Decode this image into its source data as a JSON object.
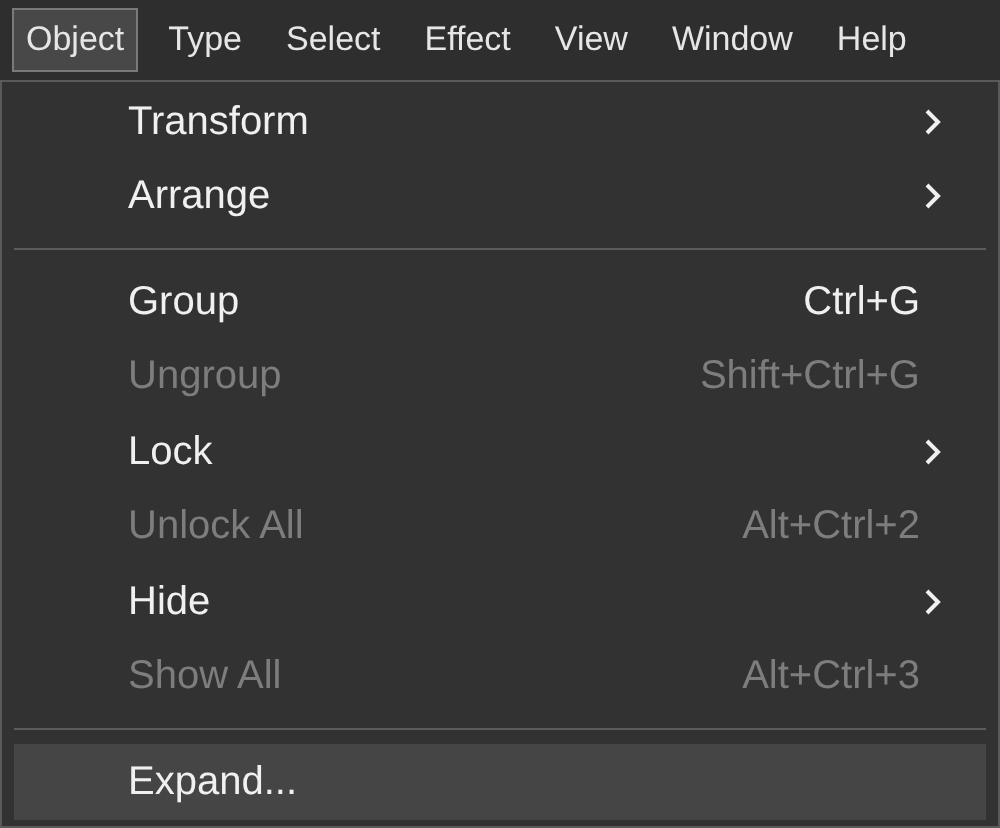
{
  "menu_bar": [
    {
      "label": "Object",
      "selected": true
    },
    {
      "label": "Type",
      "selected": false
    },
    {
      "label": "Select",
      "selected": false
    },
    {
      "label": "Effect",
      "selected": false
    },
    {
      "label": "View",
      "selected": false
    },
    {
      "label": "Window",
      "selected": false
    },
    {
      "label": "Help",
      "selected": false
    }
  ],
  "menu": [
    {
      "kind": "item",
      "label": "Transform",
      "submenu": true,
      "disabled": false,
      "highlighted": false
    },
    {
      "kind": "item",
      "label": "Arrange",
      "submenu": true,
      "disabled": false,
      "highlighted": false
    },
    {
      "kind": "separator"
    },
    {
      "kind": "item",
      "label": "Group",
      "shortcut": "Ctrl+G",
      "submenu": false,
      "disabled": false,
      "highlighted": false
    },
    {
      "kind": "item",
      "label": "Ungroup",
      "shortcut": "Shift+Ctrl+G",
      "submenu": false,
      "disabled": true,
      "highlighted": false
    },
    {
      "kind": "item",
      "label": "Lock",
      "submenu": true,
      "disabled": false,
      "highlighted": false
    },
    {
      "kind": "item",
      "label": "Unlock All",
      "shortcut": "Alt+Ctrl+2",
      "submenu": false,
      "disabled": true,
      "highlighted": false
    },
    {
      "kind": "item",
      "label": "Hide",
      "submenu": true,
      "disabled": false,
      "highlighted": false
    },
    {
      "kind": "item",
      "label": "Show All",
      "shortcut": "Alt+Ctrl+3",
      "submenu": false,
      "disabled": true,
      "highlighted": false
    },
    {
      "kind": "separator"
    },
    {
      "kind": "item",
      "label": "Expand...",
      "submenu": false,
      "disabled": false,
      "highlighted": true
    }
  ]
}
